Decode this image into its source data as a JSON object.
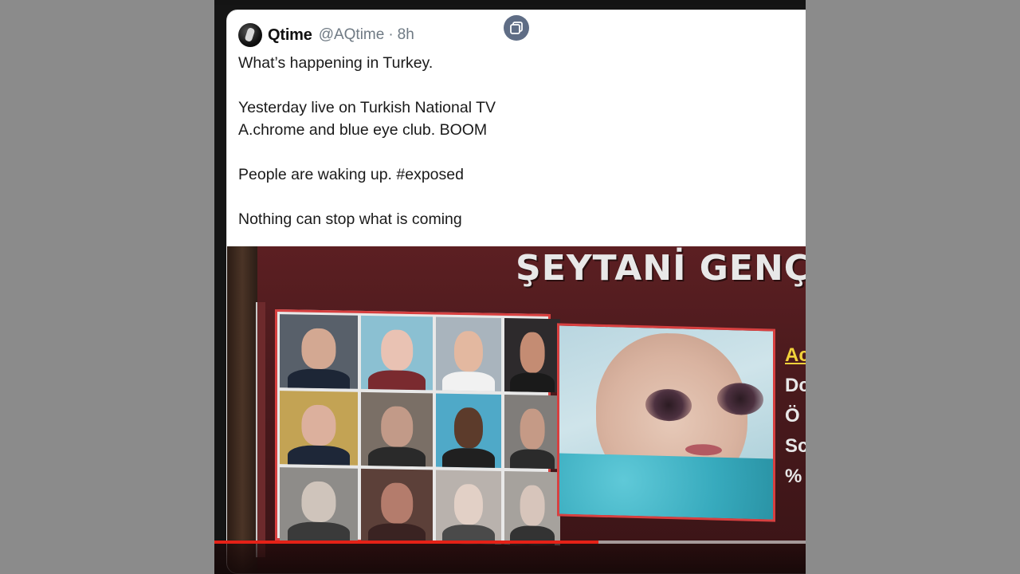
{
  "tweet": {
    "display_name": "Qtime",
    "handle": "@AQtime",
    "separator": "·",
    "age": "8h",
    "lines": [
      "What’s happening in Turkey.",
      "",
      "Yesterday live on Turkish National TV",
      "A.chrome and blue eye club. BOOM",
      "",
      "People are waking up. #exposed",
      "",
      "Nothing can stop what is coming"
    ]
  },
  "media": {
    "icon": "media-gallery-icon",
    "banner_text": "ŞEYTANİ GENÇL",
    "side_text": [
      "Ac",
      "Dc",
      "Ö",
      "Sc",
      "%"
    ]
  },
  "player": {
    "progress_percent": 65,
    "progress_color": "#e52117",
    "track_color": "#d2d2d2"
  },
  "colors": {
    "page_background": "#8b8b8b",
    "tweet_background": "#ffffff",
    "handle_color": "#6f7a84",
    "media_icon_background": "#5f6d85",
    "frame_border": "#d74040"
  }
}
